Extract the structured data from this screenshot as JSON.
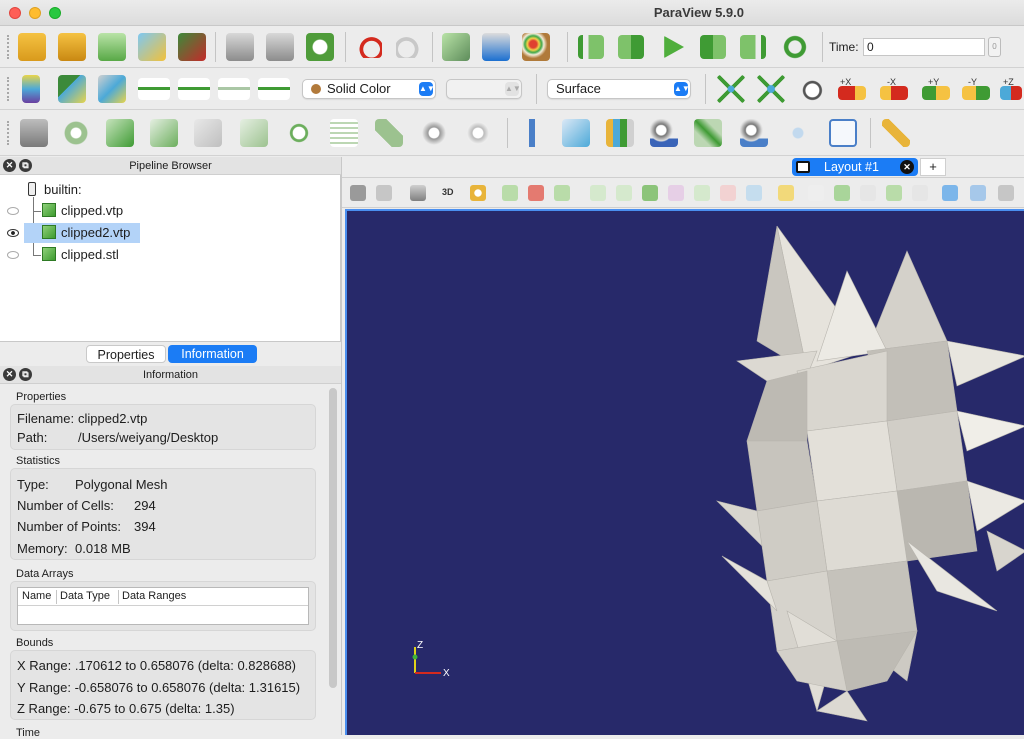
{
  "window": {
    "title": "ParaView 5.9.0"
  },
  "toolbar_main": {
    "time_label": "Time:",
    "time_value": "0",
    "time_spin": "0"
  },
  "toolbar_display": {
    "color_by": "Solid Color",
    "component": "",
    "representation": "Surface",
    "camera_labels": [
      "+X",
      "-X",
      "+Y",
      "-Y",
      "+Z"
    ]
  },
  "pipeline": {
    "title": "Pipeline Browser",
    "root": "builtin:",
    "items": [
      {
        "label": "clipped.vtp",
        "visible": false,
        "selected": false
      },
      {
        "label": "clipped2.vtp",
        "visible": true,
        "selected": true
      },
      {
        "label": "clipped.stl",
        "visible": false,
        "selected": false
      }
    ]
  },
  "tabs": {
    "properties": "Properties",
    "information": "Information"
  },
  "information": {
    "title": "Information",
    "properties_group": "Properties",
    "filename_label": "Filename:",
    "filename": "clipped2.vtp",
    "path_label": "Path:",
    "path": "/Users/weiyang/Desktop",
    "statistics_group": "Statistics",
    "type_label": "Type:",
    "type": "Polygonal Mesh",
    "cells_label": "Number of Cells:",
    "cells": "294",
    "points_label": "Number of Points:",
    "points": "394",
    "memory_label": "Memory:",
    "memory": "0.018 MB",
    "data_arrays_group": "Data Arrays",
    "columns": [
      "Name",
      "Data Type",
      "Data Ranges"
    ],
    "bounds_group": "Bounds",
    "x_range": "X Range: .170612 to 0.658076 (delta: 0.828688)",
    "y_range": "Y Range: -0.658076 to 0.658076 (delta: 1.31615)",
    "z_range": "Z Range:  -0.675 to 0.675 (delta: 1.35)",
    "time_group": "Time"
  },
  "layout": {
    "tab_label": "Layout #1",
    "add_label": "+"
  },
  "view": {
    "label_3d": "3D",
    "axis_z": "Z",
    "axis_x": "X"
  },
  "colors": {
    "background": "#27296a",
    "accent": "#1b7cf5",
    "mesh": "#dcd9d2"
  }
}
